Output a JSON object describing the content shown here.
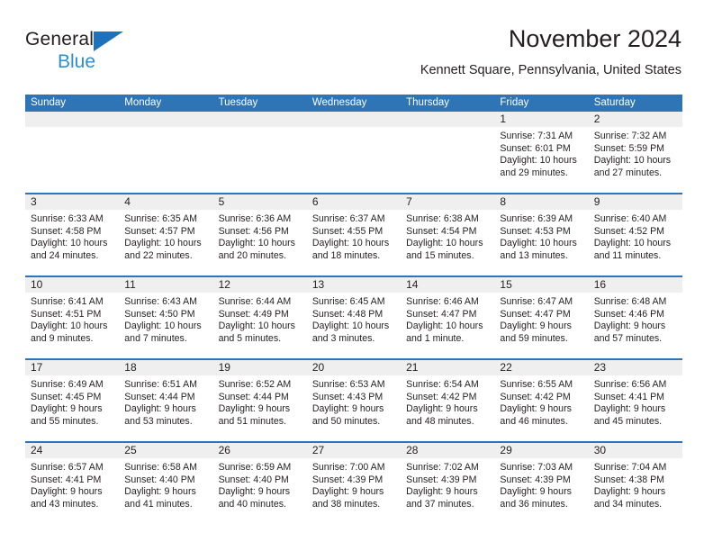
{
  "brand": {
    "line1": "General",
    "line2": "Blue",
    "triangle_color": "#1e72bb",
    "line2_color": "#2a8fd8"
  },
  "header": {
    "title": "November 2024",
    "location": "Kennett Square, Pennsylvania, United States"
  },
  "theme": {
    "header_blue": "#2f74b5",
    "daynum_band": "#efefef",
    "text": "#231f20"
  },
  "calendar": {
    "weekday_headers": [
      "Sunday",
      "Monday",
      "Tuesday",
      "Wednesday",
      "Thursday",
      "Friday",
      "Saturday"
    ],
    "weeks": [
      [
        {
          "day": "",
          "sunrise": "",
          "sunset": "",
          "daylight": ""
        },
        {
          "day": "",
          "sunrise": "",
          "sunset": "",
          "daylight": ""
        },
        {
          "day": "",
          "sunrise": "",
          "sunset": "",
          "daylight": ""
        },
        {
          "day": "",
          "sunrise": "",
          "sunset": "",
          "daylight": ""
        },
        {
          "day": "",
          "sunrise": "",
          "sunset": "",
          "daylight": ""
        },
        {
          "day": "1",
          "sunrise": "Sunrise: 7:31 AM",
          "sunset": "Sunset: 6:01 PM",
          "daylight": "Daylight: 10 hours and 29 minutes."
        },
        {
          "day": "2",
          "sunrise": "Sunrise: 7:32 AM",
          "sunset": "Sunset: 5:59 PM",
          "daylight": "Daylight: 10 hours and 27 minutes."
        }
      ],
      [
        {
          "day": "3",
          "sunrise": "Sunrise: 6:33 AM",
          "sunset": "Sunset: 4:58 PM",
          "daylight": "Daylight: 10 hours and 24 minutes."
        },
        {
          "day": "4",
          "sunrise": "Sunrise: 6:35 AM",
          "sunset": "Sunset: 4:57 PM",
          "daylight": "Daylight: 10 hours and 22 minutes."
        },
        {
          "day": "5",
          "sunrise": "Sunrise: 6:36 AM",
          "sunset": "Sunset: 4:56 PM",
          "daylight": "Daylight: 10 hours and 20 minutes."
        },
        {
          "day": "6",
          "sunrise": "Sunrise: 6:37 AM",
          "sunset": "Sunset: 4:55 PM",
          "daylight": "Daylight: 10 hours and 18 minutes."
        },
        {
          "day": "7",
          "sunrise": "Sunrise: 6:38 AM",
          "sunset": "Sunset: 4:54 PM",
          "daylight": "Daylight: 10 hours and 15 minutes."
        },
        {
          "day": "8",
          "sunrise": "Sunrise: 6:39 AM",
          "sunset": "Sunset: 4:53 PM",
          "daylight": "Daylight: 10 hours and 13 minutes."
        },
        {
          "day": "9",
          "sunrise": "Sunrise: 6:40 AM",
          "sunset": "Sunset: 4:52 PM",
          "daylight": "Daylight: 10 hours and 11 minutes."
        }
      ],
      [
        {
          "day": "10",
          "sunrise": "Sunrise: 6:41 AM",
          "sunset": "Sunset: 4:51 PM",
          "daylight": "Daylight: 10 hours and 9 minutes."
        },
        {
          "day": "11",
          "sunrise": "Sunrise: 6:43 AM",
          "sunset": "Sunset: 4:50 PM",
          "daylight": "Daylight: 10 hours and 7 minutes."
        },
        {
          "day": "12",
          "sunrise": "Sunrise: 6:44 AM",
          "sunset": "Sunset: 4:49 PM",
          "daylight": "Daylight: 10 hours and 5 minutes."
        },
        {
          "day": "13",
          "sunrise": "Sunrise: 6:45 AM",
          "sunset": "Sunset: 4:48 PM",
          "daylight": "Daylight: 10 hours and 3 minutes."
        },
        {
          "day": "14",
          "sunrise": "Sunrise: 6:46 AM",
          "sunset": "Sunset: 4:47 PM",
          "daylight": "Daylight: 10 hours and 1 minute."
        },
        {
          "day": "15",
          "sunrise": "Sunrise: 6:47 AM",
          "sunset": "Sunset: 4:47 PM",
          "daylight": "Daylight: 9 hours and 59 minutes."
        },
        {
          "day": "16",
          "sunrise": "Sunrise: 6:48 AM",
          "sunset": "Sunset: 4:46 PM",
          "daylight": "Daylight: 9 hours and 57 minutes."
        }
      ],
      [
        {
          "day": "17",
          "sunrise": "Sunrise: 6:49 AM",
          "sunset": "Sunset: 4:45 PM",
          "daylight": "Daylight: 9 hours and 55 minutes."
        },
        {
          "day": "18",
          "sunrise": "Sunrise: 6:51 AM",
          "sunset": "Sunset: 4:44 PM",
          "daylight": "Daylight: 9 hours and 53 minutes."
        },
        {
          "day": "19",
          "sunrise": "Sunrise: 6:52 AM",
          "sunset": "Sunset: 4:44 PM",
          "daylight": "Daylight: 9 hours and 51 minutes."
        },
        {
          "day": "20",
          "sunrise": "Sunrise: 6:53 AM",
          "sunset": "Sunset: 4:43 PM",
          "daylight": "Daylight: 9 hours and 50 minutes."
        },
        {
          "day": "21",
          "sunrise": "Sunrise: 6:54 AM",
          "sunset": "Sunset: 4:42 PM",
          "daylight": "Daylight: 9 hours and 48 minutes."
        },
        {
          "day": "22",
          "sunrise": "Sunrise: 6:55 AM",
          "sunset": "Sunset: 4:42 PM",
          "daylight": "Daylight: 9 hours and 46 minutes."
        },
        {
          "day": "23",
          "sunrise": "Sunrise: 6:56 AM",
          "sunset": "Sunset: 4:41 PM",
          "daylight": "Daylight: 9 hours and 45 minutes."
        }
      ],
      [
        {
          "day": "24",
          "sunrise": "Sunrise: 6:57 AM",
          "sunset": "Sunset: 4:41 PM",
          "daylight": "Daylight: 9 hours and 43 minutes."
        },
        {
          "day": "25",
          "sunrise": "Sunrise: 6:58 AM",
          "sunset": "Sunset: 4:40 PM",
          "daylight": "Daylight: 9 hours and 41 minutes."
        },
        {
          "day": "26",
          "sunrise": "Sunrise: 6:59 AM",
          "sunset": "Sunset: 4:40 PM",
          "daylight": "Daylight: 9 hours and 40 minutes."
        },
        {
          "day": "27",
          "sunrise": "Sunrise: 7:00 AM",
          "sunset": "Sunset: 4:39 PM",
          "daylight": "Daylight: 9 hours and 38 minutes."
        },
        {
          "day": "28",
          "sunrise": "Sunrise: 7:02 AM",
          "sunset": "Sunset: 4:39 PM",
          "daylight": "Daylight: 9 hours and 37 minutes."
        },
        {
          "day": "29",
          "sunrise": "Sunrise: 7:03 AM",
          "sunset": "Sunset: 4:39 PM",
          "daylight": "Daylight: 9 hours and 36 minutes."
        },
        {
          "day": "30",
          "sunrise": "Sunrise: 7:04 AM",
          "sunset": "Sunset: 4:38 PM",
          "daylight": "Daylight: 9 hours and 34 minutes."
        }
      ]
    ]
  }
}
